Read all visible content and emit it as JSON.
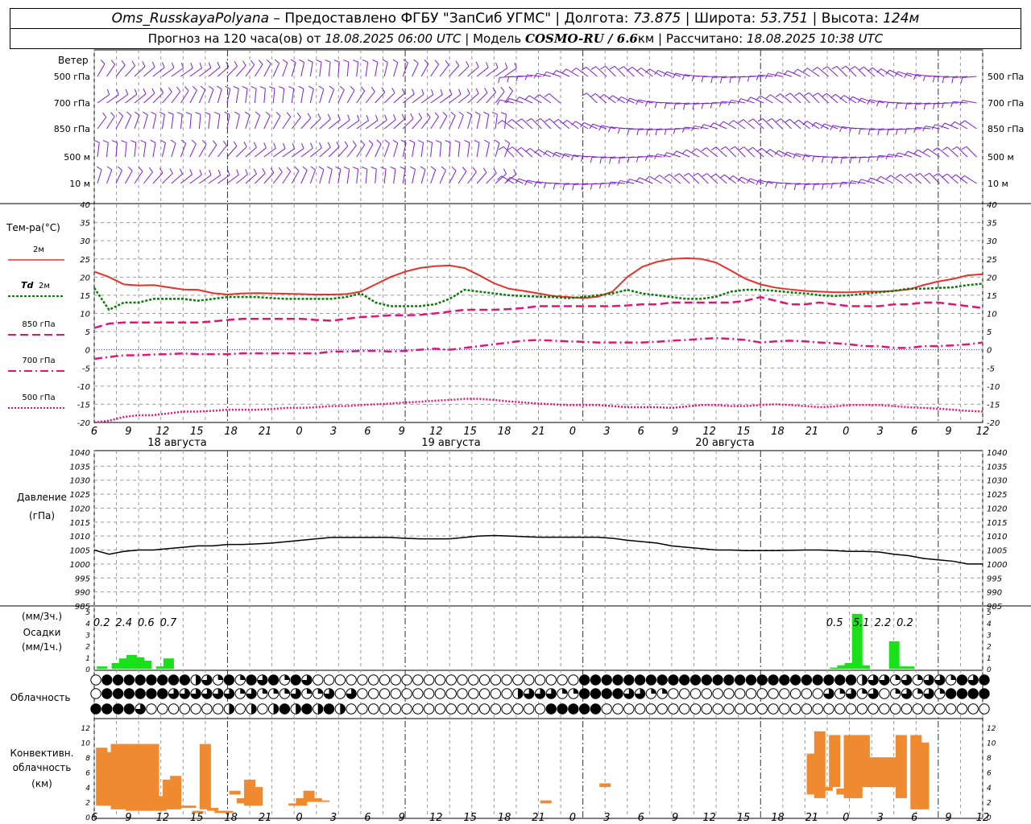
{
  "header": {
    "line1": {
      "station": "Oms_RusskayaPolyana",
      "provider": " – Предоставлено ФГБУ \"ЗапСиб УГМС\" | Долгота: ",
      "lon": "73.875",
      "lat_label": " | Широта: ",
      "lat": "53.751",
      "alt_label": " | Высота: ",
      "alt": "124м"
    },
    "line2": {
      "forecast_label": "Прогноз на 120 часа(ов) от ",
      "forecast_time": "18.08.2025 06:00 UTC",
      "model_label": " | Модель ",
      "model": "COSMO-RU / 6.6",
      "model_unit": "км",
      "calc_label": " | Рассчитано: ",
      "calc_time": "18.08.2025 10:38 UTC"
    }
  },
  "colors": {
    "wind": "#7a1fd0",
    "t2m": "#e8302a",
    "td2m": "#0a7a0a",
    "t850": "#e0157a",
    "t700": "#e0157a",
    "t500": "#e0157a",
    "pressure": "#000000",
    "precip": "#19e019",
    "convective": "#f08a30",
    "grid": "#999999",
    "zero_line": "#3030c0"
  },
  "time_axis": {
    "ticks": [
      "6",
      "9",
      "12",
      "15",
      "18",
      "21",
      "0",
      "3",
      "6",
      "9",
      "12",
      "15",
      "18",
      "21",
      "0",
      "3",
      "6",
      "9",
      "12",
      "15",
      "18",
      "21",
      "0",
      "3",
      "6",
      "9",
      "12"
    ],
    "day_labels": [
      "18 августа",
      "19 августа",
      "20 августа"
    ]
  },
  "wind_panel": {
    "title": "Ветер",
    "levels": [
      "500 гПа",
      "700 гПа",
      "850 гПа",
      "500 м",
      "10 м"
    ]
  },
  "temp_panel": {
    "title": "Тем-ра(°C)",
    "legend": [
      {
        "key": "t2m",
        "label": "2м"
      },
      {
        "key": "td2m",
        "label_it": "Td",
        "label": " 2м"
      },
      {
        "key": "t850",
        "label": "850 гПа"
      },
      {
        "key": "t700",
        "label": "700 гПа"
      },
      {
        "key": "t500",
        "label": "500 гПа"
      }
    ],
    "y_ticks": [
      "40",
      "35",
      "30",
      "25",
      "20",
      "15",
      "10",
      "5",
      "0",
      "-5",
      "-10",
      "-15",
      "-20"
    ]
  },
  "pressure_panel": {
    "title1": "Давление",
    "title2": "(гПа)",
    "y_ticks": [
      "1040",
      "1035",
      "1030",
      "1025",
      "1020",
      "1015",
      "1010",
      "1005",
      "1000",
      "995",
      "990",
      "985"
    ]
  },
  "precip_panel": {
    "title1": "(мм/3ч.)",
    "title2": "Осадки",
    "title3": "(мм/1ч.)",
    "y_ticks": [
      "5",
      "4",
      "3",
      "2",
      "1",
      "0"
    ],
    "totals": [
      {
        "h": 1,
        "text": "0.2"
      },
      {
        "h": 4,
        "text": "2.4"
      },
      {
        "h": 7,
        "text": "0.6"
      },
      {
        "h": 10,
        "text": "0.7"
      },
      {
        "h": 100,
        "text": "0.5"
      },
      {
        "h": 103.6,
        "text": "5.1"
      },
      {
        "h": 106.5,
        "text": "2.2"
      },
      {
        "h": 109.5,
        "text": "0.2"
      }
    ]
  },
  "cloud_panel": {
    "title": "Облачность"
  },
  "conv_panel": {
    "title1": "Конвективн.",
    "title2": "облачность",
    "title3": "(км)",
    "y_ticks": [
      "12",
      "10",
      "8",
      "6",
      "4",
      "2",
      "0"
    ]
  },
  "chart_data": [
    {
      "type": "line",
      "title": "Тем-ра(°C)",
      "ylim": [
        -20,
        40
      ],
      "x_hours_from_start": [
        0,
        2,
        4,
        6,
        8,
        10,
        12,
        14,
        16,
        18,
        20,
        22,
        24,
        26,
        28,
        30,
        32,
        34,
        36,
        38,
        40,
        42,
        44,
        46,
        48,
        50,
        52,
        54,
        56,
        58,
        60,
        62,
        64,
        66,
        68,
        70,
        72,
        74,
        76,
        78,
        80,
        82,
        84,
        86,
        88,
        90,
        92,
        94,
        96,
        98,
        100,
        102,
        104,
        106,
        108,
        110,
        112,
        114,
        116,
        118,
        120
      ],
      "series": [
        {
          "name": "2м",
          "values": [
            21.5,
            20,
            18,
            17.7,
            17.8,
            17.2,
            16.6,
            16.5,
            15.6,
            15.2,
            15.5,
            15.6,
            15.5,
            15.4,
            15.3,
            15.2,
            15.2,
            15.3,
            16,
            18,
            20,
            21.5,
            22.5,
            23,
            23.2,
            22.5,
            20.5,
            18.3,
            16.8,
            16.2,
            15.5,
            14.8,
            14.5,
            14.2,
            14.6,
            16,
            20,
            22.8,
            24.2,
            25,
            25.2,
            25,
            24,
            21.8,
            19.5,
            18,
            17.1,
            16.6,
            16.2,
            16,
            15.8,
            15.8,
            16,
            16,
            16.2,
            16.6,
            17.8,
            18.8,
            19.5,
            20.5,
            20.8
          ]
        },
        {
          "name": "Td 2м",
          "values": [
            17,
            11,
            13,
            13,
            14,
            14,
            14,
            13.5,
            14,
            14.5,
            14.5,
            14.5,
            14.2,
            14,
            14,
            14,
            14,
            14.5,
            15.5,
            13,
            12,
            12,
            12,
            12.5,
            14,
            16.5,
            16,
            15.5,
            15,
            14.8,
            14.6,
            14.5,
            14.2,
            14.5,
            15,
            15.5,
            16.5,
            15.5,
            15,
            14.5,
            14,
            14,
            14.6,
            16,
            16.5,
            16.5,
            16.2,
            15.8,
            15.5,
            15,
            14.8,
            15,
            15.4,
            15.8,
            16.2,
            16.8,
            16.8,
            17,
            17.2,
            17.8,
            18.2
          ]
        },
        {
          "name": "850 гПа",
          "values": [
            6,
            7.2,
            7.5,
            7.5,
            7.5,
            7.5,
            7.5,
            7.5,
            7.8,
            8.2,
            8.5,
            8.5,
            8.5,
            8.5,
            8.5,
            8.2,
            8,
            8.5,
            9,
            9.2,
            9.5,
            9.5,
            9.6,
            10,
            10.5,
            11,
            11,
            11,
            11.2,
            11.5,
            12,
            12,
            12,
            12,
            12,
            12,
            12.2,
            12.5,
            12.5,
            13,
            13,
            13,
            13,
            13,
            13.5,
            14.5,
            13.5,
            12.5,
            12.5,
            13,
            12.5,
            12,
            12,
            12,
            12.5,
            12.5,
            13,
            13,
            12.5,
            12,
            11.5
          ]
        },
        {
          "name": "700 гПа",
          "values": [
            -2.5,
            -2,
            -1.5,
            -1.5,
            -1.3,
            -1.2,
            -1,
            -1.2,
            -1.2,
            -1.2,
            -1,
            -1,
            -1,
            -1,
            -1,
            -1,
            -0.5,
            -0.5,
            -0.3,
            -0.3,
            -0.5,
            -0.3,
            0,
            0.3,
            0,
            0.5,
            1,
            1.5,
            2,
            2.5,
            2.7,
            2.5,
            2.3,
            2.2,
            2,
            2,
            2,
            2,
            2.2,
            2.5,
            2.7,
            3,
            3.2,
            3,
            2.7,
            2,
            2.3,
            2.5,
            2.3,
            2,
            1.8,
            1.5,
            1,
            1,
            0.5,
            0.5,
            1,
            1,
            1.2,
            1.5,
            2
          ]
        },
        {
          "name": "500 гПа",
          "values": [
            -20,
            -19.5,
            -18.5,
            -18,
            -18,
            -17.5,
            -17,
            -17,
            -16.8,
            -16.5,
            -16.5,
            -16.5,
            -16.3,
            -16,
            -16,
            -15.8,
            -15.5,
            -15.5,
            -15.2,
            -15,
            -14.8,
            -14.5,
            -14.3,
            -14,
            -13.8,
            -13.5,
            -13.5,
            -13.8,
            -14.2,
            -14.5,
            -14.8,
            -15,
            -15.2,
            -15.2,
            -15.2,
            -15.5,
            -15.8,
            -15.8,
            -15.8,
            -16,
            -15.6,
            -15.2,
            -15.2,
            -15.5,
            -15.5,
            -15.2,
            -15,
            -15.2,
            -15.5,
            -15.8,
            -15.6,
            -15.2,
            -15.2,
            -15.2,
            -15.5,
            -15.8,
            -16,
            -16.2,
            -16.5,
            -16.8,
            -17
          ]
        }
      ]
    },
    {
      "type": "line",
      "title": "Давление (гПа)",
      "ylim": [
        985,
        1040
      ],
      "x_hours_from_start": [
        0,
        2,
        4,
        6,
        8,
        10,
        12,
        14,
        16,
        18,
        20,
        22,
        24,
        26,
        28,
        30,
        32,
        34,
        36,
        38,
        40,
        42,
        44,
        46,
        48,
        50,
        52,
        54,
        56,
        58,
        60,
        62,
        64,
        66,
        68,
        70,
        72,
        74,
        76,
        78,
        80,
        82,
        84,
        86,
        88,
        90,
        92,
        94,
        96,
        98,
        100,
        102,
        104,
        106,
        108,
        110,
        112,
        114,
        116,
        118,
        120
      ],
      "series": [
        {
          "name": "Давление",
          "values": [
            1005,
            1003.5,
            1004.5,
            1005,
            1005,
            1005.5,
            1006,
            1006.5,
            1006.5,
            1007,
            1007,
            1007.2,
            1007.5,
            1008,
            1008.5,
            1009,
            1009.5,
            1009.5,
            1009.5,
            1009.5,
            1009.5,
            1009.2,
            1009,
            1009,
            1009,
            1009.5,
            1010,
            1010.2,
            1010,
            1009.8,
            1009.6,
            1009.6,
            1009.6,
            1009.6,
            1009.6,
            1009.2,
            1008.5,
            1008,
            1007.5,
            1006.5,
            1006,
            1005.5,
            1005,
            1005,
            1004.8,
            1004.8,
            1004.8,
            1004.9,
            1005,
            1005,
            1004.8,
            1004.5,
            1004.5,
            1004.3,
            1003.5,
            1003,
            1002,
            1001.5,
            1001,
            1000,
            1000
          ]
        }
      ]
    },
    {
      "type": "bar",
      "title": "Осадки (мм/1ч.)",
      "ylim": [
        0,
        5
      ],
      "x_hours_from_start": [
        1,
        2,
        3,
        4,
        5,
        6,
        7,
        8,
        9,
        10,
        11,
        100,
        101,
        102,
        103,
        104,
        105,
        106,
        107,
        108,
        109,
        110
      ],
      "values": [
        0.2,
        0,
        0.5,
        0.9,
        1.2,
        1,
        0.7,
        0,
        0.2,
        0.9,
        0,
        0.1,
        0.3,
        0.5,
        4.8,
        0.3,
        0,
        0,
        0,
        2.4,
        0.2,
        0.2
      ]
    },
    {
      "type": "bar",
      "title": "Конвективн. облачность (км)",
      "ylim": [
        0,
        13
      ],
      "bars": [
        {
          "x": 1,
          "lo": 1.5,
          "hi": 9.3
        },
        {
          "x": 2,
          "lo": 1.5,
          "hi": 8.7
        },
        {
          "x": 3,
          "lo": 1,
          "hi": 9.8
        },
        {
          "x": 4,
          "lo": 1,
          "hi": 9.8
        },
        {
          "x": 5,
          "lo": 0.8,
          "hi": 9.8
        },
        {
          "x": 6,
          "lo": 0.8,
          "hi": 9.8
        },
        {
          "x": 7,
          "lo": 0.8,
          "hi": 9.8
        },
        {
          "x": 8,
          "lo": 0.8,
          "hi": 9.8
        },
        {
          "x": 9,
          "lo": 0.8,
          "hi": 2.8
        },
        {
          "x": 10,
          "lo": 1,
          "hi": 5
        },
        {
          "x": 11,
          "lo": 1,
          "hi": 5.5
        },
        {
          "x": 12,
          "lo": 1.2,
          "hi": 1.5
        },
        {
          "x": 13,
          "lo": 1.2,
          "hi": 1.5
        },
        {
          "x": 14,
          "lo": 0.5,
          "hi": 0.8
        },
        {
          "x": 15,
          "lo": 1,
          "hi": 9.8
        },
        {
          "x": 16,
          "lo": 0.8,
          "hi": 1.2
        },
        {
          "x": 17,
          "lo": 0.5,
          "hi": 0.8
        },
        {
          "x": 18,
          "lo": 0.5,
          "hi": 0.8
        },
        {
          "x": 19,
          "lo": 3,
          "hi": 3.5
        },
        {
          "x": 20,
          "lo": 1.8,
          "hi": 2.5
        },
        {
          "x": 21,
          "lo": 1.5,
          "hi": 5
        },
        {
          "x": 22,
          "lo": 1.5,
          "hi": 4
        },
        {
          "x": 27,
          "lo": 1.5,
          "hi": 1.8
        },
        {
          "x": 28,
          "lo": 1.5,
          "hi": 2.5
        },
        {
          "x": 29,
          "lo": 2,
          "hi": 3.5
        },
        {
          "x": 30,
          "lo": 2,
          "hi": 2.5
        },
        {
          "x": 31,
          "lo": 2,
          "hi": 2.2
        },
        {
          "x": 61,
          "lo": 1.8,
          "hi": 2.2
        },
        {
          "x": 69,
          "lo": 4,
          "hi": 4.5
        },
        {
          "x": 97,
          "lo": 3,
          "hi": 8.5
        },
        {
          "x": 98,
          "lo": 2.5,
          "hi": 11.5
        },
        {
          "x": 99,
          "lo": 3.5,
          "hi": 4
        },
        {
          "x": 100,
          "lo": 4,
          "hi": 11
        },
        {
          "x": 101,
          "lo": 3,
          "hi": 3.8
        },
        {
          "x": 102,
          "lo": 2.5,
          "hi": 11
        },
        {
          "x": 103,
          "lo": 2.5,
          "hi": 11
        },
        {
          "x": 104,
          "lo": 4,
          "hi": 11
        },
        {
          "x": 105,
          "lo": 4,
          "hi": 8
        },
        {
          "x": 106,
          "lo": 4,
          "hi": 8
        },
        {
          "x": 107,
          "lo": 4,
          "hi": 8
        },
        {
          "x": 108,
          "lo": 4,
          "hi": 8
        },
        {
          "x": 109,
          "lo": 2.5,
          "hi": 11
        },
        {
          "x": 111,
          "lo": 1,
          "hi": 11
        },
        {
          "x": 112,
          "lo": 1,
          "hi": 10
        }
      ]
    }
  ]
}
